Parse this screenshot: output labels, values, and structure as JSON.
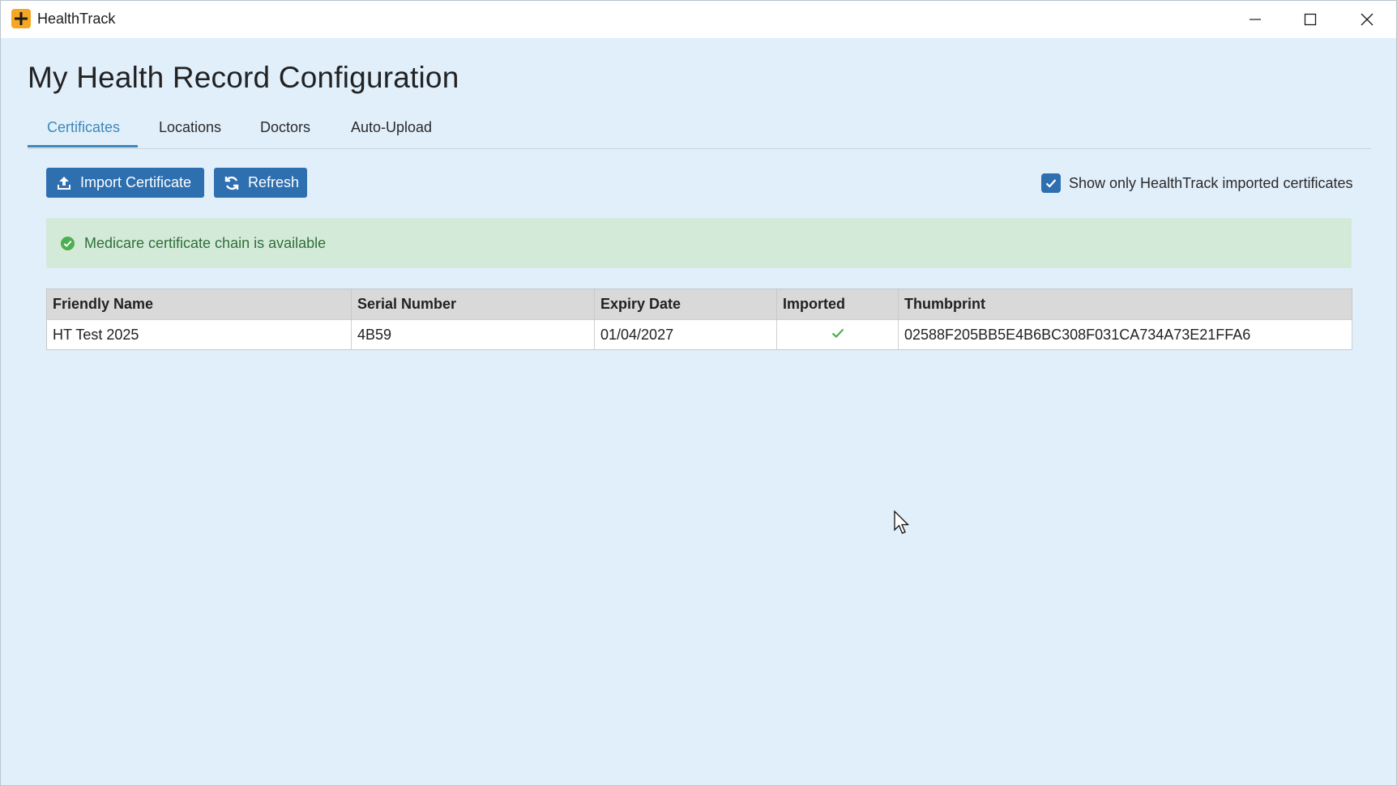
{
  "window": {
    "title": "HealthTrack",
    "controls": [
      "minimize",
      "maximize",
      "close"
    ]
  },
  "page": {
    "title": "My Health Record Configuration"
  },
  "tabs": [
    {
      "label": "Certificates",
      "active": true
    },
    {
      "label": "Locations",
      "active": false
    },
    {
      "label": "Doctors",
      "active": false
    },
    {
      "label": "Auto-Upload",
      "active": false
    }
  ],
  "toolbar": {
    "import_label": "Import Certificate",
    "import_icon": "upload-icon",
    "refresh_label": "Refresh",
    "refresh_icon": "refresh-icon",
    "filter_label": "Show only HealthTrack imported certificates",
    "filter_checked": true
  },
  "alert": {
    "text": "Medicare certificate chain is available",
    "icon": "check-circle-icon",
    "color": "#2f6f3a"
  },
  "table": {
    "columns": [
      "Friendly Name",
      "Serial Number",
      "Expiry Date",
      "Imported",
      "Thumbprint"
    ],
    "rows": [
      {
        "friendly_name": "HT Test 2025",
        "serial_number": "4B59",
        "expiry_date": "01/04/2027",
        "imported": true,
        "thumbprint": "02588F205BB5E4B6BC308F031CA734A73E21FFA6"
      }
    ]
  },
  "colors": {
    "accent": "#2e6fb0",
    "tab_active": "#3d88b8",
    "background": "#e1effb",
    "success_bg": "#d4ead9",
    "check_green": "#4caf50"
  }
}
